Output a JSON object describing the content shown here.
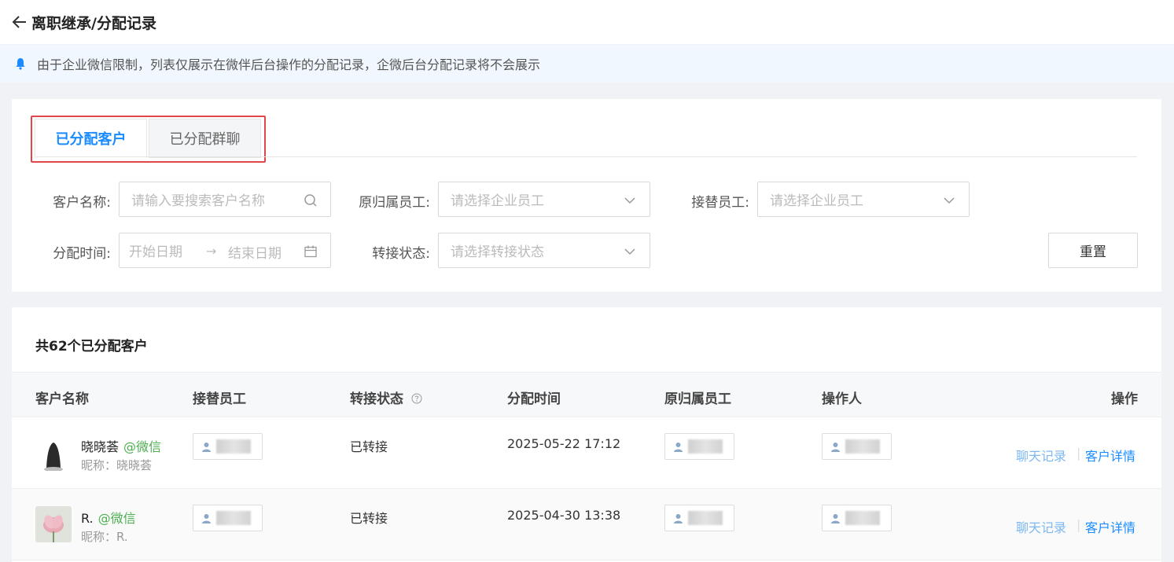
{
  "header": {
    "title": "离职继承/分配记录"
  },
  "notice": {
    "text": "由于企业微信限制，列表仅展示在微伴后台操作的分配记录，企微后台分配记录将不会展示"
  },
  "tabs": [
    {
      "label": "已分配客户",
      "active": true
    },
    {
      "label": "已分配群聊",
      "active": false
    }
  ],
  "filters": {
    "customer_name": {
      "label": "客户名称:",
      "placeholder": "请输入要搜索客户名称"
    },
    "original_employee": {
      "label": "原归属员工:",
      "placeholder": "请选择企业员工"
    },
    "successor_employee": {
      "label": "接替员工:",
      "placeholder": "请选择企业员工"
    },
    "assign_time": {
      "label": "分配时间:",
      "start_placeholder": "开始日期",
      "end_placeholder": "结束日期"
    },
    "transfer_status": {
      "label": "转接状态:",
      "placeholder": "请选择转接状态"
    },
    "reset_label": "重置"
  },
  "list": {
    "count_text": "共62个已分配客户",
    "columns": [
      "客户名称",
      "接替员工",
      "转接状态",
      "分配时间",
      "原归属员工",
      "操作人",
      "操作"
    ],
    "rows": [
      {
        "name": "晓晓荟",
        "source": "@微信",
        "nickname": "昵称：晓晓荟",
        "status": "已转接",
        "assign_time": "2025-05-22 17:12",
        "chat_action": "聊天记录",
        "detail_action": "客户详情"
      },
      {
        "name": "R.",
        "source": "@微信",
        "nickname": "昵称：R.",
        "status": "已转接",
        "assign_time": "2025-04-30 13:38",
        "chat_action": "聊天记录",
        "detail_action": "客户详情"
      }
    ]
  },
  "colors": {
    "accent": "#1a8cff",
    "wechat": "#4caf50",
    "highlight_border": "#e0464a"
  }
}
